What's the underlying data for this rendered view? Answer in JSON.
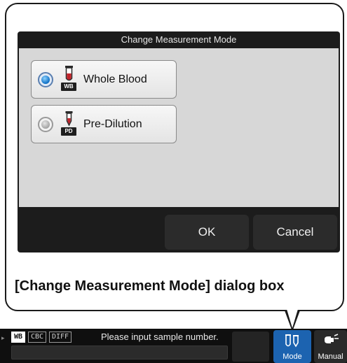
{
  "dialog": {
    "title": "Change Measurement Mode",
    "options": [
      {
        "label": "Whole Blood",
        "badge": "WB",
        "selected": true
      },
      {
        "label": "Pre-Dilution",
        "badge": "PD",
        "selected": false
      }
    ],
    "ok_label": "OK",
    "cancel_label": "Cancel"
  },
  "caption": "[Change Measurement Mode] dialog box",
  "statusbar": {
    "tags": [
      "WB",
      "CBC",
      "DIFF"
    ],
    "message": "Please input sample number.",
    "mode_label": "Mode",
    "manual_label": "Manual"
  },
  "colors": {
    "dialog_bg": "#1c1c1c",
    "body_bg": "#d7d7d7",
    "accent_blue": "#1c63b0",
    "tube_red": "#c0242b"
  },
  "icons": {
    "tube": "test-tube-icon",
    "mode": "tube-pair-icon",
    "manual": "manual-icon"
  }
}
